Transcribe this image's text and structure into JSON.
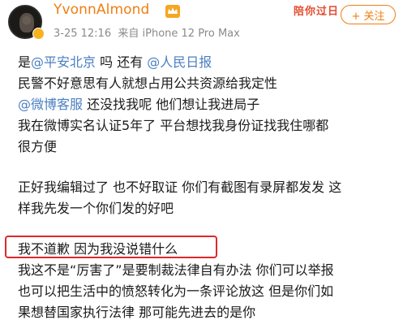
{
  "header": {
    "username": "YvonnAlmond",
    "timestamp": "3-25 12:16",
    "source": "来自 iPhone 12 Pro Max",
    "tag_text": "陪你过日",
    "follow_label": "+ 关注"
  },
  "post": {
    "line1": {
      "a": "是",
      "m1": "@平安北京",
      "b": " 吗 还有 ",
      "m2": "@人民日报"
    },
    "line2": "民警不好意思有人就想占用公共资源给我定性",
    "line3": {
      "m": "@微博客服",
      "b": " 还没找我呢 他们想让我进局子"
    },
    "line4": "我在微博实名认证5年了 平台想找我身份证找我住哪都",
    "line5": "很方便",
    "line6": "正好我编辑过了 也不好取证 你们有截图有录屏都发发 这",
    "line7": "样我先发一个你们发的好吧",
    "line8": "我不道歉 因为我没说错什么",
    "line9": "我这不是“厉害了”是要制裁法律自有办法 你们可以举报",
    "line10": "也可以把生活中的愤怒转化为一条评论放这 但是你们如",
    "line11": "果想替国家执行法律 那可能先进去的是你"
  },
  "colors": {
    "username": "#ef7e12",
    "mention": "#4a7fc1",
    "highlight_border": "#e02828",
    "meta": "#8a8a8a"
  }
}
